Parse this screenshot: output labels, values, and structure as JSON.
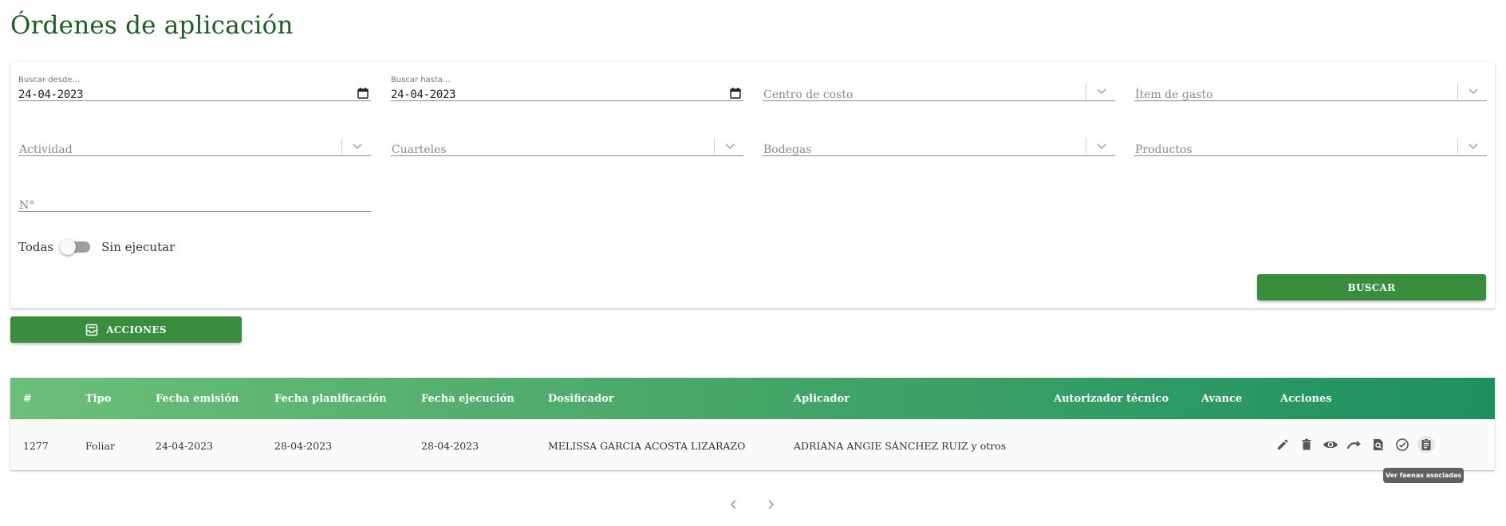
{
  "page": {
    "title": "Órdenes de aplicación"
  },
  "filters": {
    "date_from": {
      "label": "Buscar desde...",
      "value": "24-04-2023"
    },
    "date_to": {
      "label": "Buscar hasta...",
      "value": "24-04-2023"
    },
    "cost_center": {
      "placeholder": "Centro de costo"
    },
    "expense_item": {
      "placeholder": "Ítem de gasto"
    },
    "activity": {
      "placeholder": "Actividad"
    },
    "quarters": {
      "placeholder": "Cuarteles"
    },
    "warehouses": {
      "placeholder": "Bodegas"
    },
    "products": {
      "placeholder": "Productos"
    },
    "number": {
      "placeholder": "N°"
    },
    "toggle": {
      "left_label": "Todas",
      "right_label": "Sin ejecutar",
      "checked": false
    },
    "search_button": "BUSCAR"
  },
  "actions_button": {
    "label": "ACCIONES",
    "icon": "inbox-tray-icon"
  },
  "table": {
    "columns": [
      "#",
      "Tipo",
      "Fecha emisión",
      "Fecha planificación",
      "Fecha ejecución",
      "Dosificador",
      "Aplicador",
      "Autorizador técnico",
      "Avance",
      "Acciones"
    ],
    "rows": [
      {
        "id": "1277",
        "tipo": "Foliar",
        "fecha_emision": "24-04-2023",
        "fecha_planificacion": "28-04-2023",
        "fecha_ejecucion": "28-04-2023",
        "dosificador": "MELISSA GARCIA ACOSTA LIZARAZO",
        "aplicador": "ADRIANA ANGIE SÁNCHEZ RUIZ y otros",
        "autorizador": "",
        "avance": "",
        "actions": [
          "pencil-icon",
          "trash-icon",
          "eye-icon",
          "forward-arrow-icon",
          "document-search-icon",
          "check-circle-icon",
          "clipboard-icon"
        ]
      }
    ],
    "header_gradient": [
      "#6cbf78",
      "#1e9060"
    ]
  },
  "tooltip": "Ver faenas asociadas",
  "pagination": {
    "prev_icon": "chevron-left-icon",
    "next_icon": "chevron-right-icon"
  },
  "colors": {
    "title": "#1b5e20",
    "button": "#388e3c",
    "tooltip": "#616161"
  }
}
